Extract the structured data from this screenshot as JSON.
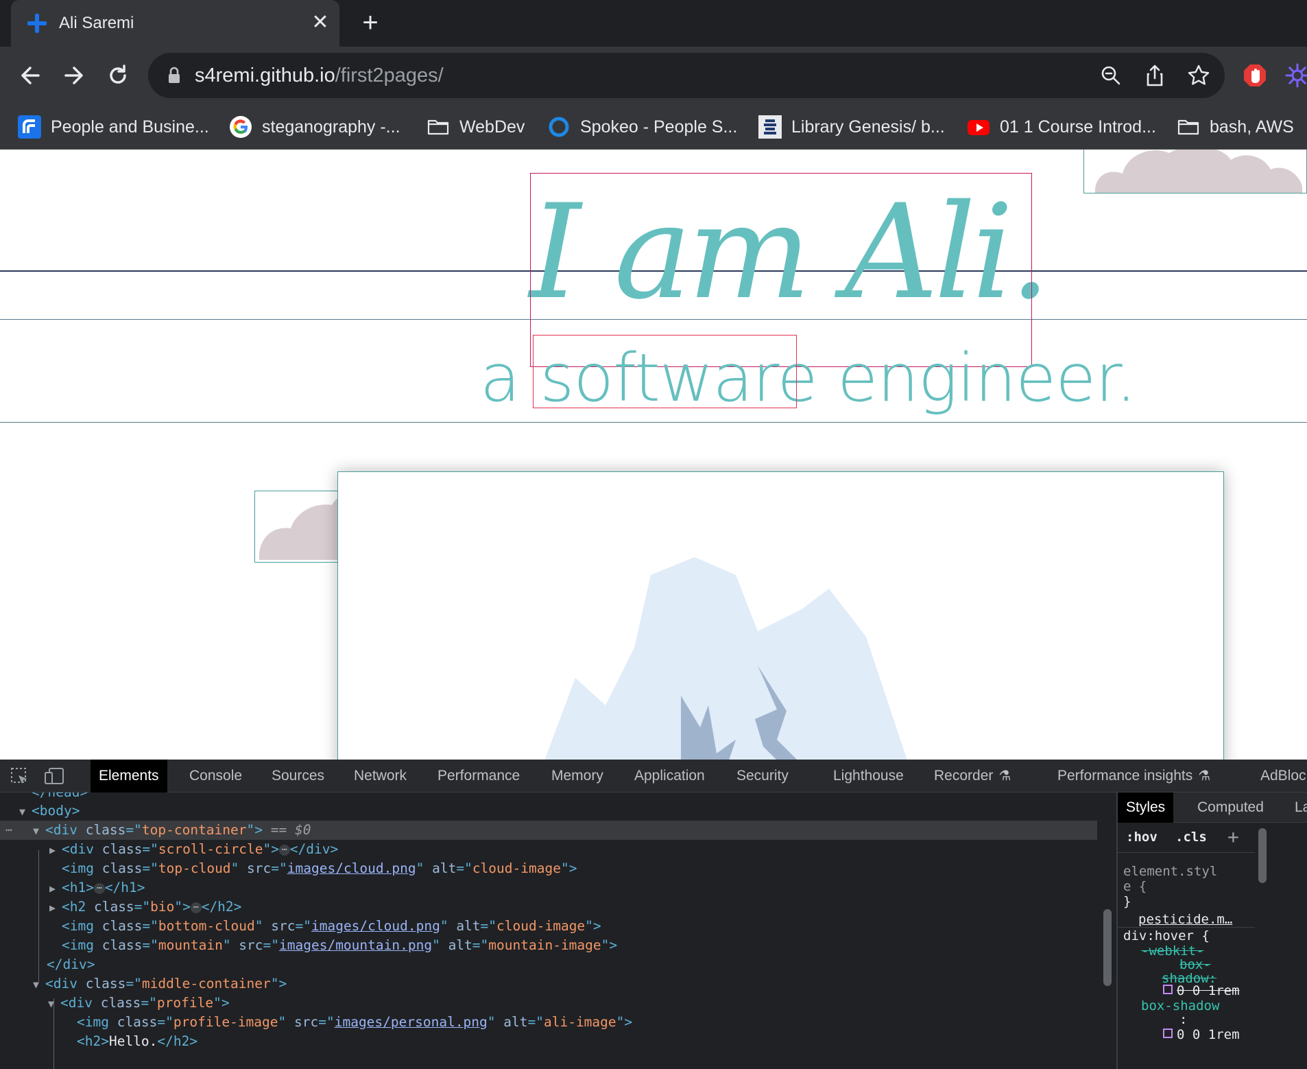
{
  "browser": {
    "tab_title": "Ali Saremi",
    "url_host": "s4remi.github.io",
    "url_path": "/first2pages/",
    "bookmarks": [
      {
        "label": "People and Busine..."
      },
      {
        "label": "steganography -..."
      },
      {
        "label": "WebDev"
      },
      {
        "label": "Spokeo - People S..."
      },
      {
        "label": "Library Genesis/ b..."
      },
      {
        "label": "01 1 Course Introd..."
      },
      {
        "label": "bash, AWS"
      }
    ]
  },
  "page": {
    "heading": "I am Ali.",
    "bio": "a software engineer.",
    "colors": {
      "accent": "#66bfbf",
      "cloud": "#d8cdd1",
      "mountain_light": "#e0ecf8",
      "mountain_dark": "#9fb3cc"
    }
  },
  "devtools": {
    "tabs": [
      "Elements",
      "Console",
      "Sources",
      "Network",
      "Performance",
      "Memory",
      "Application",
      "Security",
      "Lighthouse",
      "Recorder",
      "Performance insights",
      "AdBloc"
    ],
    "dom": {
      "head_close": "</head>",
      "body_open": "<body>",
      "top_container_class": "top-container",
      "selected_marker": "== $0",
      "scroll_circle_class": "scroll-circle",
      "top_cloud_class": "top-cloud",
      "cloud_src": "images/cloud.png",
      "cloud_alt": "cloud-image",
      "h1_tag": "h1",
      "bio_class": "bio",
      "bottom_cloud_class": "bottom-cloud",
      "mountain_class": "mountain",
      "mountain_src": "images/mountain.png",
      "mountain_alt": "mountain-image",
      "middle_container_class": "middle-container",
      "profile_class": "profile",
      "profile_image_class": "profile-image",
      "profile_src": "images/personal.png",
      "profile_alt": "ali-image",
      "h2_text": "Hello."
    },
    "styles_pane": {
      "tabs": [
        "Styles",
        "Computed",
        "Lay"
      ],
      "filter_hov": ":hov",
      "filter_cls": ".cls",
      "element_style_1": "element.styl",
      "element_style_2": "e {",
      "brace_close": "}",
      "source": "pesticide.m…",
      "selector": "div:hover {",
      "webkit_prop_1": "-webkit-",
      "webkit_prop_2": "box-",
      "webkit_prop_3": "shadow:",
      "value_1": "0 0 1rem",
      "box_shadow_prop": "box-shadow",
      "colon": ":",
      "value_2": "0 0 1rem"
    }
  }
}
